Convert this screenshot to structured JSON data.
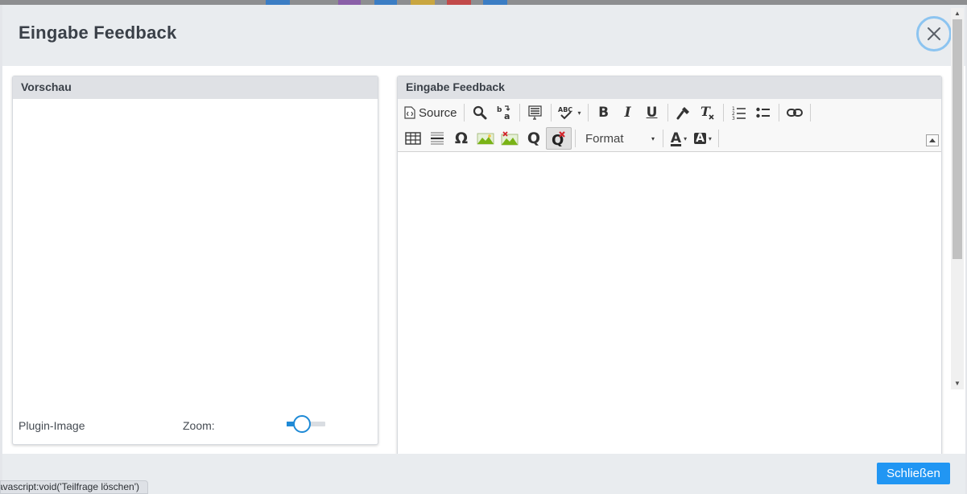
{
  "dialog": {
    "title": "Eingabe Feedback",
    "close_icon": "close-icon"
  },
  "preview_panel": {
    "title": "Vorschau",
    "plugin_label": "Plugin-Image",
    "zoom_label": "Zoom:",
    "zoom_level": 0.4
  },
  "editor_panel": {
    "title": "Eingabe Feedback",
    "toolbar": {
      "source_label": "Source",
      "format_label": "Format",
      "format_caret": "▾",
      "row1_icons": [
        "source-icon",
        "find-icon",
        "replace-icon",
        "select-all-icon",
        "spellcheck-icon",
        "bold-icon",
        "italic-icon",
        "underline-icon",
        "copy-format-icon",
        "remove-format-icon",
        "numbered-list-icon",
        "bulleted-list-icon",
        "link-icon"
      ],
      "row2_icons": [
        "table-icon",
        "horizontal-line-icon",
        "special-char-icon",
        "image-icon",
        "remove-image-icon",
        "question-icon",
        "remove-question-icon",
        "format-dropdown",
        "text-color-icon",
        "background-color-icon"
      ],
      "glyphs": {
        "bold": "B",
        "italic": "I",
        "underline": "U",
        "omega": "Ω",
        "text_color": "A",
        "bg_color": "A",
        "question": "Q",
        "spell": "ABC"
      }
    }
  },
  "footer": {
    "close_label": "Schließen"
  },
  "status_bar": {
    "link_text": "avascript:void('Teilfrage löschen')"
  },
  "colors": {
    "accent": "#2196f3",
    "slider": "#1f8ad6",
    "close_ring": "#8cc4f0"
  }
}
